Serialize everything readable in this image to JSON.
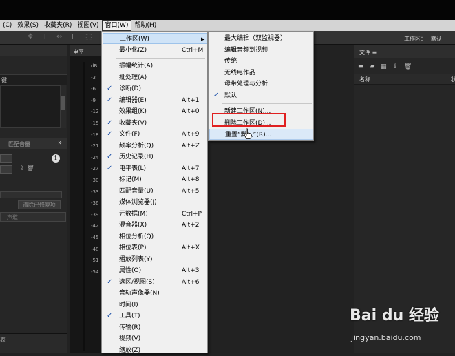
{
  "menubar": {
    "items": [
      "(C)",
      "效果(S)",
      "收藏夹(R)",
      "视图(V)",
      "窗口(W)",
      "帮助(H)"
    ],
    "active_index": 4
  },
  "toolbar": {
    "workspace_label": "工作区：",
    "workspace_value": "默认"
  },
  "left_panel": {
    "key_label": "键",
    "tab_label": "匹配音量",
    "more": "»",
    "clear_button": "清除已修复项",
    "field_label": "声道",
    "bottom_label": "表"
  },
  "meter": {
    "title": "电平",
    "scale": [
      "dB",
      "-3",
      "-6",
      "-9",
      "-12",
      "-15",
      "-18",
      "-21",
      "-24",
      "-27",
      "-30",
      "-33",
      "-36",
      "-39",
      "-42",
      "-45",
      "-48",
      "-51",
      "-54"
    ]
  },
  "files_panel": {
    "title": "文件 ≡",
    "col_name": "名称",
    "col_state": "状"
  },
  "window_menu": {
    "items": [
      {
        "label": "工作区(W)",
        "shortcut": "",
        "checked": false,
        "submenu": true,
        "highlighted": true
      },
      {
        "label": "最小化(Z)",
        "shortcut": "Ctrl+M",
        "checked": false
      },
      {
        "separator": true
      },
      {
        "label": "振幅统计(A)",
        "shortcut": "",
        "checked": false
      },
      {
        "label": "批处理(A)",
        "shortcut": "",
        "checked": false
      },
      {
        "label": "诊断(D)",
        "shortcut": "",
        "checked": true
      },
      {
        "label": "编辑器(E)",
        "shortcut": "Alt+1",
        "checked": true
      },
      {
        "label": "效果组(K)",
        "shortcut": "Alt+0",
        "checked": false
      },
      {
        "label": "收藏夹(V)",
        "shortcut": "",
        "checked": true
      },
      {
        "label": "文件(F)",
        "shortcut": "Alt+9",
        "checked": true
      },
      {
        "label": "频率分析(Q)",
        "shortcut": "Alt+Z",
        "checked": false
      },
      {
        "label": "历史记录(H)",
        "shortcut": "",
        "checked": true
      },
      {
        "label": "电平表(L)",
        "shortcut": "Alt+7",
        "checked": true
      },
      {
        "label": "标记(M)",
        "shortcut": "Alt+8",
        "checked": false
      },
      {
        "label": "匹配音量(U)",
        "shortcut": "Alt+5",
        "checked": false
      },
      {
        "label": "媒体浏览器(J)",
        "shortcut": "",
        "checked": false
      },
      {
        "label": "元数据(M)",
        "shortcut": "Ctrl+P",
        "checked": false
      },
      {
        "label": "混音器(X)",
        "shortcut": "Alt+2",
        "checked": false
      },
      {
        "label": "相位分析(Q)",
        "shortcut": "",
        "checked": false
      },
      {
        "label": "相位表(P)",
        "shortcut": "Alt+X",
        "checked": false
      },
      {
        "label": "播放列表(Y)",
        "shortcut": "",
        "checked": false
      },
      {
        "label": "属性(O)",
        "shortcut": "Alt+3",
        "checked": false
      },
      {
        "label": "选区/视图(S)",
        "shortcut": "Alt+6",
        "checked": true
      },
      {
        "label": "音轨声像器(N)",
        "shortcut": "",
        "checked": false
      },
      {
        "label": "时间(I)",
        "shortcut": "",
        "checked": false
      },
      {
        "label": "工具(T)",
        "shortcut": "",
        "checked": true
      },
      {
        "label": "传输(R)",
        "shortcut": "",
        "checked": false
      },
      {
        "label": "视频(V)",
        "shortcut": "",
        "checked": false
      },
      {
        "label": "缩放(Z)",
        "shortcut": "",
        "checked": false
      }
    ]
  },
  "workspace_submenu": {
    "items": [
      {
        "label": "最大编辑（双监视器）",
        "checked": false
      },
      {
        "label": "编辑音频到视频",
        "checked": false
      },
      {
        "label": "传统",
        "checked": false
      },
      {
        "label": "无线电作品",
        "checked": false
      },
      {
        "label": "母带处理与分析",
        "checked": false
      },
      {
        "label": "默认",
        "checked": true
      },
      {
        "separator": true
      },
      {
        "label": "新建工作区(N)...",
        "checked": false
      },
      {
        "label": "删除工作区(D)...",
        "checked": false
      },
      {
        "label": "重置“默认”(R)...",
        "checked": false,
        "highlighted": true
      }
    ]
  },
  "watermark": {
    "brand": "Bai du 经验",
    "url": "jingyan.baidu.com"
  },
  "colors": {
    "highlight_box": "#e02020",
    "check": "#1a4fa8"
  }
}
